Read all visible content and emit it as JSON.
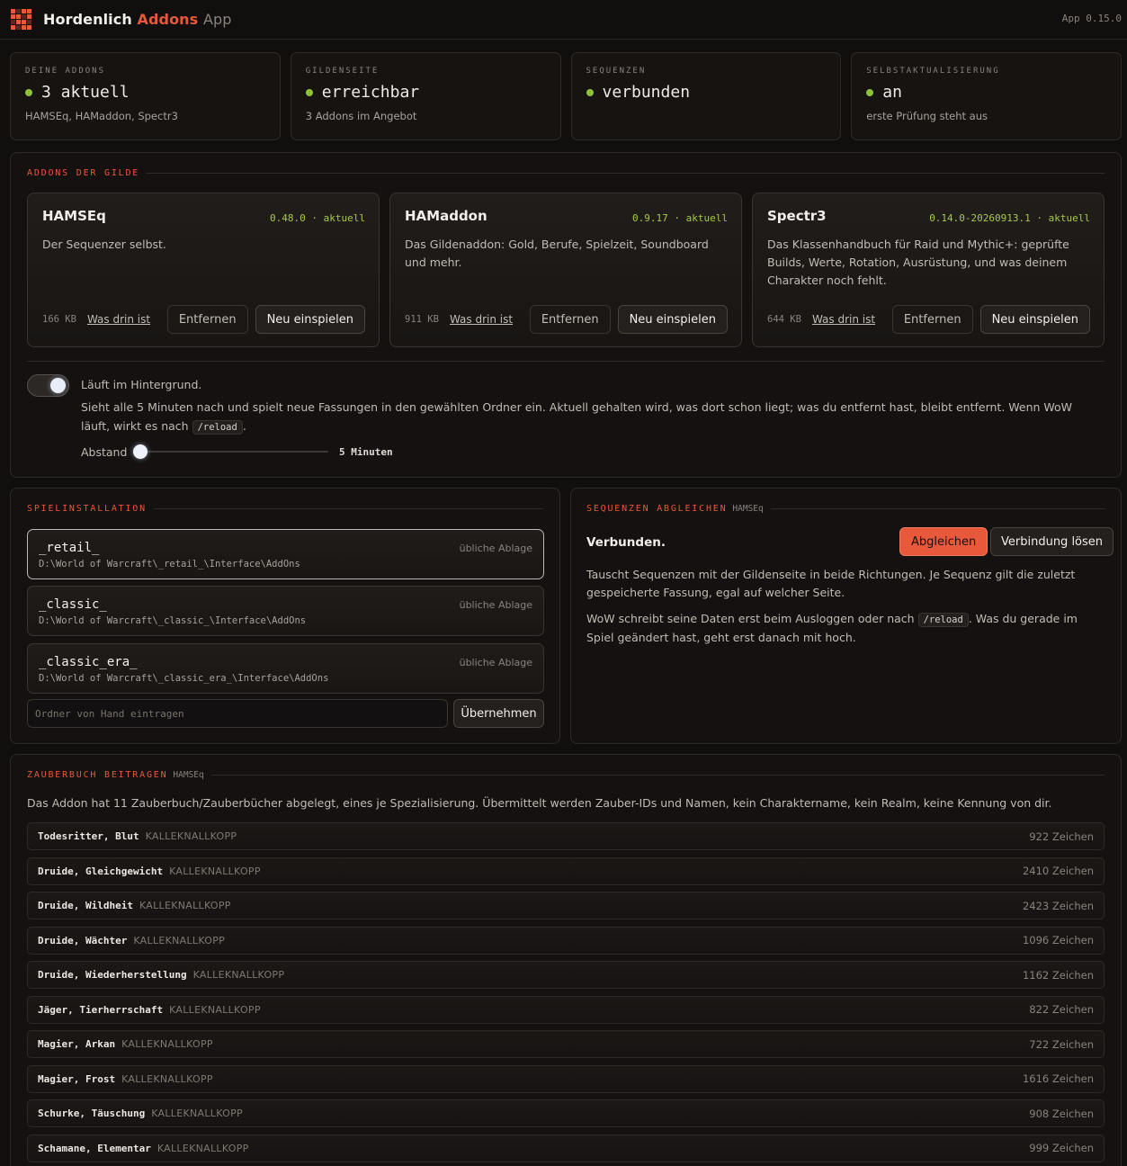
{
  "app": {
    "brand_1": "Hordenlich",
    "brand_2": "Addons",
    "brand_3": "App",
    "version": "App 0.15.0",
    "accent": "#e8583a",
    "ok_color": "#8fc23b"
  },
  "status": [
    {
      "label": "DEINE ADDONS",
      "value": "3 aktuell",
      "sub": "HAMSEq, HAMaddon, Spectr3"
    },
    {
      "label": "GILDENSEITE",
      "value": "erreichbar",
      "sub": "3 Addons im Angebot"
    },
    {
      "label": "SEQUENZEN",
      "value": "verbunden",
      "sub": ""
    },
    {
      "label": "SELBSTAKTUALISIERUNG",
      "value": "an",
      "sub": "erste Prüfung steht aus"
    }
  ],
  "guild_addons": {
    "title": "ADDONS DER GILDE",
    "items": [
      {
        "name": "HAMSEq",
        "version": "0.48.0 · aktuell",
        "desc": "Der Sequenzer selbst.",
        "size": "166 KB",
        "link": "Was drin ist",
        "remove": "Entfernen",
        "reinstall": "Neu einspielen"
      },
      {
        "name": "HAMaddon",
        "version": "0.9.17 · aktuell",
        "desc": "Das Gildenaddon: Gold, Berufe, Spielzeit, Soundboard und mehr.",
        "size": "911 KB",
        "link": "Was drin ist",
        "remove": "Entfernen",
        "reinstall": "Neu einspielen"
      },
      {
        "name": "Spectr3",
        "version": "0.14.0-20260913.1 · aktuell",
        "desc": "Das Klassenhandbuch für Raid und Mythic+: geprüfte Builds, Werte, Rotation, Ausrüstung, und was deinem Charakter noch fehlt.",
        "size": "644 KB",
        "link": "Was drin ist",
        "remove": "Entfernen",
        "reinstall": "Neu einspielen"
      }
    ],
    "background": {
      "enabled": true,
      "title": "Läuft im Hintergrund.",
      "desc_before": "Sieht alle 5 Minuten nach und spielt neue Fassungen in den gewählten Ordner ein. Aktuell gehalten wird, was dort schon liegt; was du entfernt hast, bleibt entfernt. Wenn WoW läuft, wirkt es nach",
      "desc_code": "/reload",
      "desc_after": ".",
      "interval_label": "Abstand",
      "interval_value": "5 Minuten",
      "interval_fraction": 0.0
    }
  },
  "install": {
    "title": "SPIELINSTALLATION",
    "items": [
      {
        "name": "_retail_",
        "path": "D:\\World of Warcraft\\_retail_\\Interface\\AddOns",
        "hint": "übliche Ablage",
        "selected": true
      },
      {
        "name": "_classic_",
        "path": "D:\\World of Warcraft\\_classic_\\Interface\\AddOns",
        "hint": "übliche Ablage",
        "selected": false
      },
      {
        "name": "_classic_era_",
        "path": "D:\\World of Warcraft\\_classic_era_\\Interface\\AddOns",
        "hint": "übliche Ablage",
        "selected": false
      }
    ],
    "manual_placeholder": "Ordner von Hand eintragen",
    "apply": "Übernehmen"
  },
  "sync": {
    "title": "SEQUENZEN ABGLEICHEN",
    "tag": "HAMSEq",
    "status": "Verbunden.",
    "sync_button": "Abgleichen",
    "disconnect_button": "Verbindung lösen",
    "text_1": "Tauscht Sequenzen mit der Gildenseite in beide Richtungen. Je Sequenz gilt die zuletzt gespeicherte Fassung, egal auf welcher Seite.",
    "text_2_before": "WoW schreibt seine Daten erst beim Ausloggen oder nach",
    "text_2_code": "/reload",
    "text_2_after": ". Was du gerade im Spiel geändert hast, geht erst danach mit hoch."
  },
  "spellbook": {
    "title": "ZAUBERBUCH BEITRAGEN",
    "tag": "HAMSEq",
    "desc": "Das Addon hat 11 Zauberbuch/Zauberbücher abgelegt, eines je Spezialisierung. Übermittelt werden Zauber-IDs und Namen, kein Charaktername, kein Realm, keine Kennung von dir.",
    "rows": [
      {
        "spec": "Todesritter, Blut",
        "char": "KALLEKNALLKOPP",
        "count": "922 Zeichen"
      },
      {
        "spec": "Druide, Gleichgewicht",
        "char": "KALLEKNALLKOPP",
        "count": "2410 Zeichen"
      },
      {
        "spec": "Druide, Wildheit",
        "char": "KALLEKNALLKOPP",
        "count": "2423 Zeichen"
      },
      {
        "spec": "Druide, Wächter",
        "char": "KALLEKNALLKOPP",
        "count": "1096 Zeichen"
      },
      {
        "spec": "Druide, Wiederherstellung",
        "char": "KALLEKNALLKOPP",
        "count": "1162 Zeichen"
      },
      {
        "spec": "Jäger, Tierherrschaft",
        "char": "KALLEKNALLKOPP",
        "count": "822 Zeichen"
      },
      {
        "spec": "Magier, Arkan",
        "char": "KALLEKNALLKOPP",
        "count": "722 Zeichen"
      },
      {
        "spec": "Magier, Frost",
        "char": "KALLEKNALLKOPP",
        "count": "1616 Zeichen"
      },
      {
        "spec": "Schurke, Täuschung",
        "char": "KALLEKNALLKOPP",
        "count": "908 Zeichen"
      },
      {
        "spec": "Schamane, Elementar",
        "char": "KALLEKNALLKOPP",
        "count": "999 Zeichen"
      }
    ]
  }
}
